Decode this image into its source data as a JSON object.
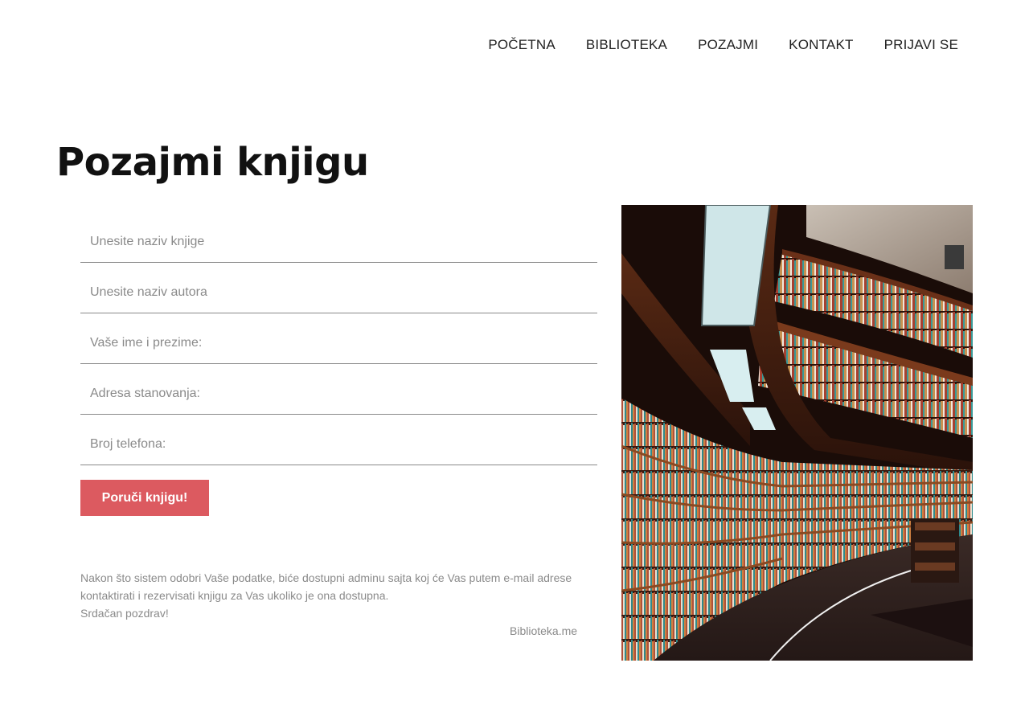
{
  "nav": {
    "items": [
      {
        "label": "POČETNA"
      },
      {
        "label": "BIBLIOTEKA"
      },
      {
        "label": "POZAJMI"
      },
      {
        "label": "KONTAKT"
      },
      {
        "label": "PRIJAVI SE"
      }
    ]
  },
  "page": {
    "title": "Pozajmi knjigu"
  },
  "form": {
    "book_title_placeholder": "Unesite naziv knjige",
    "author_placeholder": "Unesite naziv autora",
    "name_placeholder": "Vaše ime i prezime:",
    "address_placeholder": "Adresa stanovanja:",
    "phone_placeholder": "Broj telefona:",
    "submit_label": "Poruči knjigu!"
  },
  "note": {
    "text": "Nakon što sistem odobri Vaše podatke, biće dostupni adminu sajta koj će Vas putem e-mail adrese kontaktirati i rezervisati knjigu za Vas ukoliko je ona dostupna.",
    "greeting": "Srdačan pozdrav!",
    "signature": "Biblioteka.me"
  },
  "colors": {
    "accent": "#dc5a60",
    "text_muted": "#8a8a8a"
  }
}
